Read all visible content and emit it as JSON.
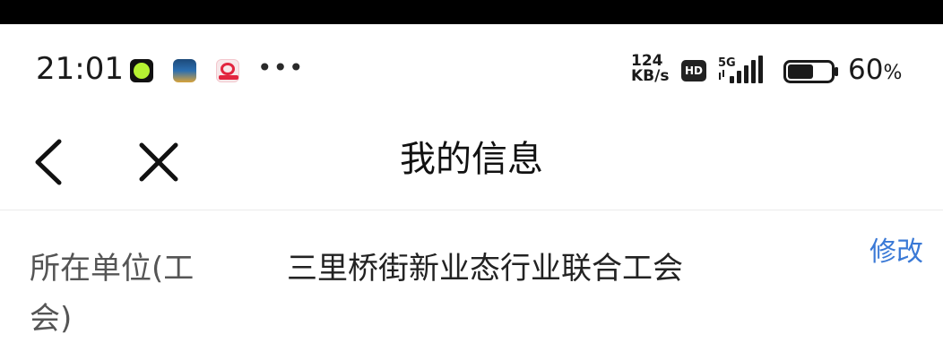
{
  "status_bar": {
    "time": "21:01",
    "more": "•••",
    "net_speed_value": "124",
    "net_speed_unit": "KB/s",
    "hd_badge": "HD",
    "network_type": "5G",
    "battery_value": "60",
    "battery_unit": "%",
    "battery_level_fraction": 0.6
  },
  "nav": {
    "title": "我的信息"
  },
  "info": {
    "label": "所在单位(工会)",
    "value": "三里桥街新业态行业联合工会",
    "edit_label": "修改"
  },
  "colors": {
    "accent": "#3a79d6",
    "text_primary": "#222222",
    "text_secondary": "#555555"
  }
}
